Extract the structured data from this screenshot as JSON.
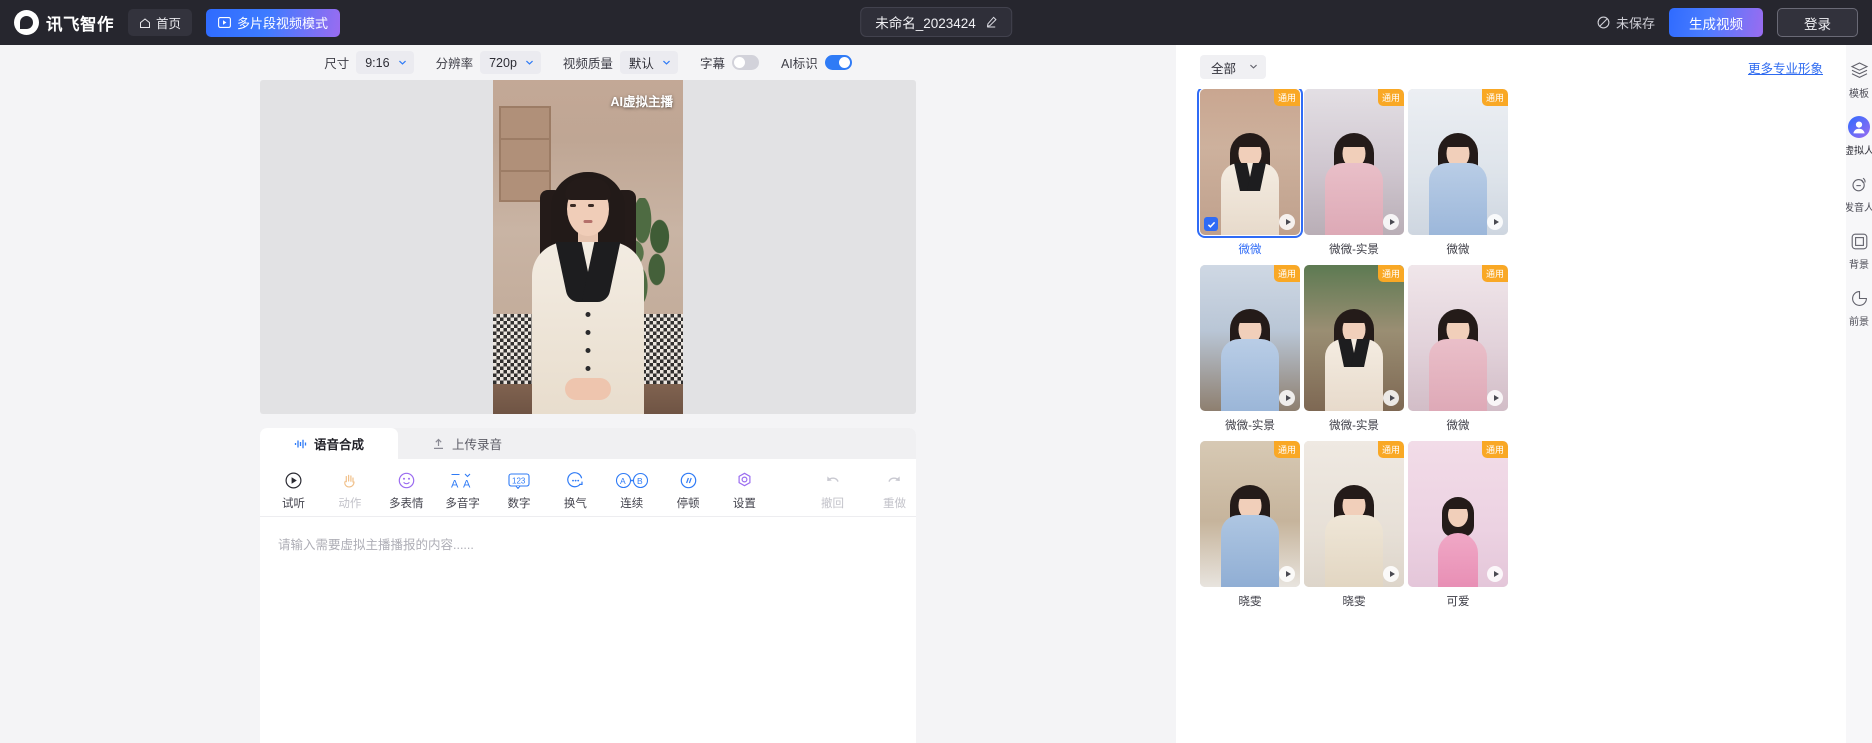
{
  "app": {
    "brand_name": "讯飞智作",
    "logo_icon": "headphone-logo-icon",
    "home_label": "首页",
    "home_icon": "home-icon",
    "multi_segment_label": "多片段视频模式",
    "multi_segment_icon": "video-mode-icon",
    "doc_title": "未命名_2023424",
    "doc_edit_icon": "pencil-icon",
    "save_state": "未保存",
    "save_state_icon": "unsaved-slash-icon",
    "generate_label": "生成视频",
    "login_label": "登录",
    "accent_blue": "#2f6bf6",
    "accent_purple": "#9a6cf0",
    "badge_orange": "#f9a825"
  },
  "settings": {
    "size": {
      "label": "尺寸",
      "value": "9:16",
      "icon": "chevron-down-icon"
    },
    "resolution": {
      "label": "分辨率",
      "value": "720p",
      "icon": "chevron-down-icon"
    },
    "quality": {
      "label": "视频质量",
      "value": "默认",
      "icon": "chevron-down-icon"
    },
    "subtitle": {
      "label": "字幕",
      "enabled": false
    },
    "ai_mark": {
      "label": "AI标识",
      "enabled": true
    }
  },
  "stage": {
    "watermark": "AI虚拟主播",
    "aspect_note": "9:16"
  },
  "editor": {
    "tabs": [
      {
        "label": "语音合成",
        "icon": "waveform-icon",
        "active": true
      },
      {
        "label": "上传录音",
        "icon": "upload-icon",
        "active": false
      }
    ],
    "tools": [
      {
        "label": "试听",
        "icon": "play-circle-icon",
        "disabled": false
      },
      {
        "label": "动作",
        "icon": "hand-wave-icon",
        "disabled": true
      },
      {
        "label": "多表情",
        "icon": "smiley-icon",
        "disabled": false
      },
      {
        "label": "多音字",
        "icon": "double-a-icon",
        "disabled": false
      },
      {
        "label": "数字",
        "icon": "number-123-icon",
        "disabled": false
      },
      {
        "label": "换气",
        "icon": "breath-icon",
        "disabled": false
      },
      {
        "label": "连续",
        "icon": "a-b-link-icon",
        "disabled": false
      },
      {
        "label": "停顿",
        "icon": "pause-slash-icon",
        "disabled": false
      },
      {
        "label": "设置",
        "icon": "hex-gear-icon",
        "disabled": false
      }
    ],
    "history": [
      {
        "label": "撤回",
        "icon": "undo-icon",
        "disabled": true
      },
      {
        "label": "重做",
        "icon": "redo-icon",
        "disabled": true
      }
    ],
    "input_placeholder": "请输入需要虚拟主播播报的内容......"
  },
  "avatar_panel": {
    "filter": {
      "value": "全部",
      "icon": "chevron-down-icon"
    },
    "more_link": "更多专业形象",
    "badge_text": "通用",
    "cards": [
      {
        "label": "微微",
        "selected": true,
        "scene": "studio-cream",
        "badge": "通用"
      },
      {
        "label": "微微-实景",
        "selected": false,
        "scene": "room-pink",
        "badge": "通用"
      },
      {
        "label": "微微",
        "selected": false,
        "scene": "studio-blue",
        "badge": "通用"
      },
      {
        "label": "微微-实景",
        "selected": false,
        "scene": "room-blue",
        "badge": "通用"
      },
      {
        "label": "微微-实景",
        "selected": false,
        "scene": "room-cream",
        "badge": "通用"
      },
      {
        "label": "微微",
        "selected": false,
        "scene": "studio-pink",
        "badge": "通用"
      },
      {
        "label": "晓雯",
        "selected": false,
        "scene": "office-blue",
        "badge": "通用"
      },
      {
        "label": "晓雯",
        "selected": false,
        "scene": "studio-beige",
        "badge": "通用"
      },
      {
        "label": "可爱",
        "selected": false,
        "scene": "kid-pink",
        "badge": "通用"
      }
    ]
  },
  "rail": {
    "items": [
      {
        "label": "模板",
        "icon": "layers-icon",
        "active": false
      },
      {
        "label": "虚拟人",
        "icon": "person-avatar-icon",
        "active": true
      },
      {
        "label": "发音人",
        "icon": "voice-speaker-icon",
        "active": false
      },
      {
        "label": "背景",
        "icon": "background-square-icon",
        "active": false
      },
      {
        "label": "前景",
        "icon": "foreground-shape-icon",
        "active": false
      }
    ]
  }
}
